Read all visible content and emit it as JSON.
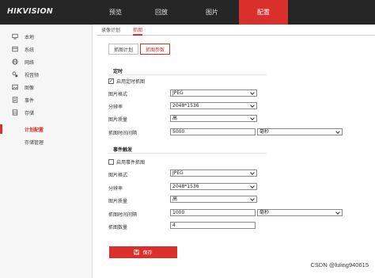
{
  "brand": {
    "logo": "HIKVISION"
  },
  "topnav": [
    "预览",
    "回放",
    "图片",
    "配置"
  ],
  "sidebar": {
    "items": [
      "本地",
      "系统",
      "网络",
      "视音频",
      "图像",
      "事件",
      "存储"
    ],
    "subitems": [
      "计划配置",
      "存储管理"
    ],
    "active_sub": "计划配置"
  },
  "tabs": {
    "primary": [
      "录像计划",
      "抓图"
    ],
    "secondary": [
      "抓图计划",
      "抓图参数"
    ]
  },
  "timing": {
    "title": "定时",
    "enable_label": "启用定时抓图",
    "enabled": true,
    "fields": {
      "format_label": "图片格式",
      "format": "JPEG",
      "resolution_label": "分辨率",
      "resolution": "2048*1536",
      "quality_label": "图片质量",
      "quality": "高",
      "interval_label": "抓图时间间隔",
      "interval": "5000",
      "unit": "毫秒"
    }
  },
  "event": {
    "title": "事件触发",
    "enable_label": "启用事件抓图",
    "enabled": false,
    "fields": {
      "format_label": "图片格式",
      "format": "JPEG",
      "resolution_label": "分辨率",
      "resolution": "2048*1536",
      "quality_label": "图片质量",
      "quality": "高",
      "interval_label": "抓图时间间隔",
      "interval": "1000",
      "unit": "毫秒",
      "count_label": "抓图数量",
      "count": "4"
    }
  },
  "save_label": "保存",
  "watermark": "CSDN @luling940615",
  "colors": {
    "accent": "#d9302b",
    "topbar": "#262626",
    "sidebar": "#f6f6f6"
  },
  "icons": [
    "monitor-icon",
    "system-icon",
    "globe-icon",
    "av-icon",
    "image-icon",
    "event-icon",
    "storage-icon",
    "save-icon"
  ]
}
